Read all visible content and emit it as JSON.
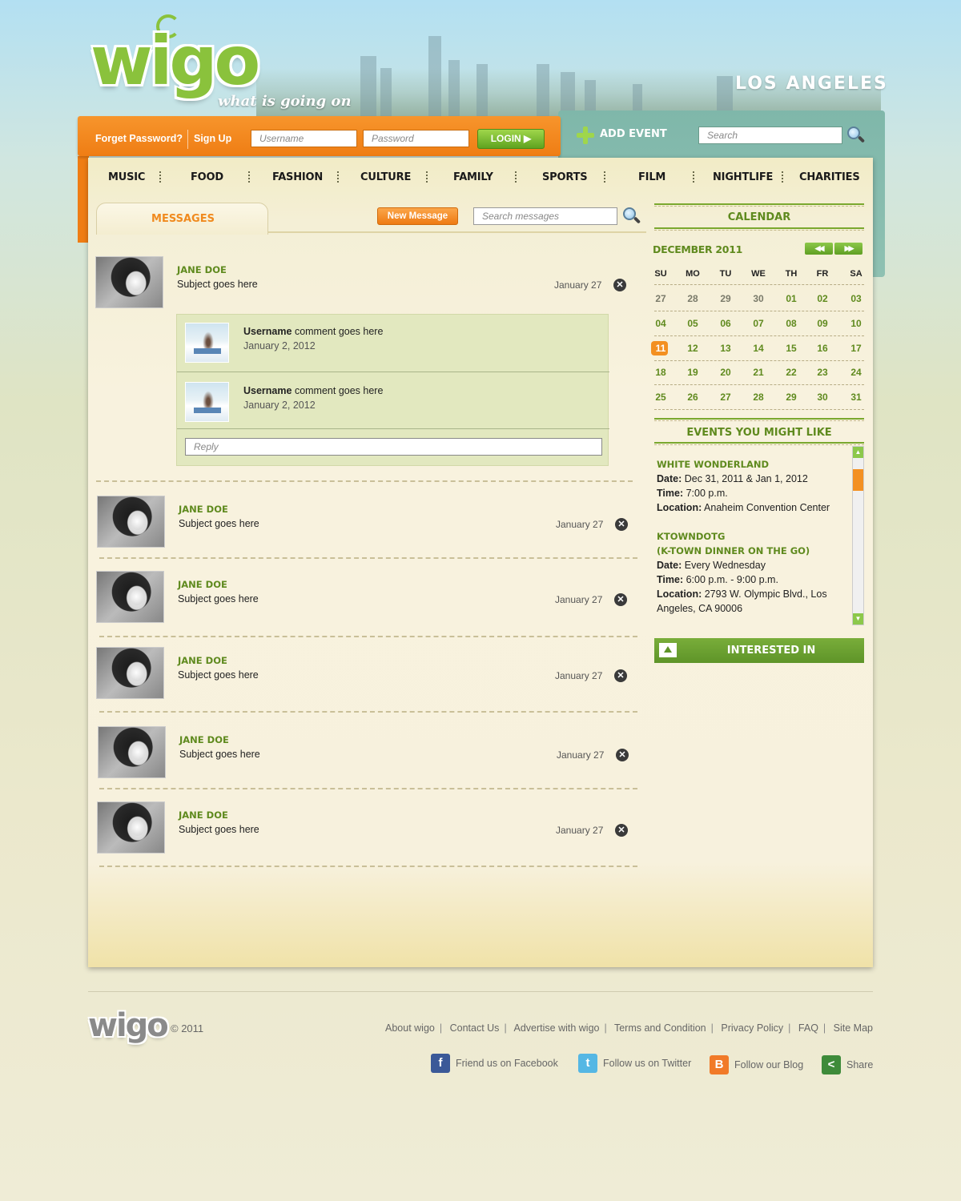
{
  "header": {
    "logo": "wigo",
    "tagline": "what is going on",
    "city": "LOS ANGELES"
  },
  "topbar": {
    "forgot_password": "Forget Password?",
    "sign_up": "Sign Up",
    "username_placeholder": "Username",
    "password_placeholder": "Password",
    "login_label": "LOGIN ▶",
    "add_event": "ADD EVENT",
    "search_placeholder": "Search"
  },
  "nav": [
    "MUSIC",
    "FOOD",
    "FASHION",
    "CULTURE",
    "FAMILY",
    "SPORTS",
    "FILM",
    "NIGHTLIFE",
    "CHARITIES"
  ],
  "messages": {
    "tab_label": "MESSAGES",
    "new_message": "New Message",
    "search_placeholder": "Search messages",
    "items": [
      {
        "name": "JANE DOE",
        "subject": "Subject goes here",
        "date": "January 27"
      },
      {
        "name": "JANE DOE",
        "subject": "Subject goes here",
        "date": "January 27"
      },
      {
        "name": "JANE DOE",
        "subject": "Subject goes here",
        "date": "January 27"
      },
      {
        "name": "JANE DOE",
        "subject": "Subject goes here",
        "date": "January 27"
      },
      {
        "name": "JANE DOE",
        "subject": "Subject goes here",
        "date": "January 27"
      },
      {
        "name": "JANE DOE",
        "subject": "Subject goes here",
        "date": "January 27"
      }
    ],
    "thread": {
      "comments": [
        {
          "user": "Username",
          "text": "comment goes here",
          "date": "January 2, 2012"
        },
        {
          "user": "Username",
          "text": "comment goes here",
          "date": "January 2, 2012"
        }
      ],
      "reply_placeholder": "Reply"
    }
  },
  "calendar": {
    "title": "CALENDAR",
    "month": "DECEMBER 2011",
    "prev_label": "◀◀",
    "next_label": "▶▶",
    "days_of_week": [
      "SU",
      "MO",
      "TU",
      "WE",
      "TH",
      "FR",
      "SA"
    ],
    "weeks": [
      [
        "27",
        "28",
        "29",
        "30",
        "01",
        "02",
        "03"
      ],
      [
        "04",
        "05",
        "06",
        "07",
        "08",
        "09",
        "10"
      ],
      [
        "11",
        "12",
        "13",
        "14",
        "15",
        "16",
        "17"
      ],
      [
        "18",
        "19",
        "20",
        "21",
        "22",
        "23",
        "24"
      ],
      [
        "25",
        "26",
        "27",
        "28",
        "29",
        "30",
        "31"
      ]
    ],
    "today": "11"
  },
  "events": {
    "title": "EVENTS YOU MIGHT LIKE",
    "items": [
      {
        "title_lines": [
          "WHITE WONDERLAND"
        ],
        "date_label": "Date:",
        "date": "Dec 31, 2011 & Jan 1, 2012",
        "time_label": "Time:",
        "time": "7:00 p.m.",
        "location_label": "Location:",
        "location_lines": [
          "Anaheim Convention Center"
        ]
      },
      {
        "title_lines": [
          "KTOWNDOTG",
          "(K-TOWN DINNER ON THE GO)"
        ],
        "date_label": "Date:",
        "date": "Every Wednesday",
        "time_label": "Time:",
        "time": "6:00 p.m. - 9:00 p.m.",
        "location_label": "Location:",
        "location_lines": [
          "2793 W. Olympic Blvd., Los",
          "Angeles, CA 90006"
        ]
      }
    ]
  },
  "interested": {
    "label": "INTERESTED IN"
  },
  "footer": {
    "logo": "wigo",
    "copyright": "© 2011",
    "links": [
      "About wigo",
      "Contact Us",
      "Advertise with wigo",
      "Terms and Condition",
      "Privacy Policy",
      "FAQ",
      "Site Map"
    ],
    "social": [
      {
        "label": "Friend us on Facebook",
        "icon": "facebook-icon",
        "glyph": "f",
        "color": "#3b5998"
      },
      {
        "label": "Follow us on Twitter",
        "icon": "twitter-icon",
        "glyph": "t",
        "color": "#55b7e4"
      },
      {
        "label": "Follow our Blog",
        "icon": "blogger-icon",
        "glyph": "B",
        "color": "#f17a28"
      },
      {
        "label": "Share",
        "icon": "share-icon",
        "glyph": "<",
        "color": "#3e8b3a"
      }
    ]
  },
  "colors": {
    "orange": "#f39021",
    "green": "#5f8a1e",
    "teal": "#8fc1b2"
  }
}
